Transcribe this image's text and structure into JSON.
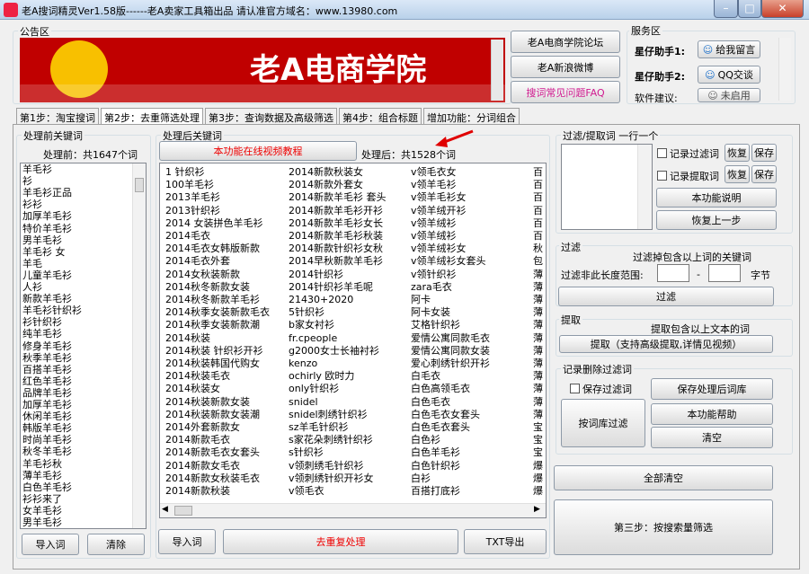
{
  "window": {
    "title": "老A搜词精灵Ver1.58版------老A卖家工具箱出品  请认准官方域名：www.13980.com"
  },
  "header": {
    "announcement_label": "公告区",
    "banner_text": "老A电商学院",
    "links": [
      "老A电商学院论坛",
      "老A新浪微博",
      "搜词常见问题FAQ"
    ],
    "service_label": "服务区",
    "assistant1_label": "星仔助手1:",
    "assistant1_btn": "给我留言",
    "assistant2_label": "星仔助手2:",
    "assistant2_btn": "QQ交谈",
    "suggest_label": "软件建议:",
    "suggest_btn": "未启用"
  },
  "tabs": [
    "第1步：淘宝搜词",
    "第2步：去重筛选处理",
    "第3步：查询数据及高级筛选",
    "第4步：组合标题",
    "增加功能：分词组合"
  ],
  "left": {
    "group_label": "处理前关键词",
    "count_label": "处理前：共1647个词",
    "keywords": [
      "羊毛衫",
      "衫",
      "羊毛衫正品",
      "衫衫",
      "加厚羊毛衫",
      "特价羊毛衫",
      "男羊毛衫",
      "羊毛衫 女",
      "羊毛",
      "儿童羊毛衫",
      "人衫",
      "新款羊毛衫",
      "羊毛衫针织衫",
      "衫针织衫",
      "纯羊毛衫",
      "修身羊毛衫",
      "秋季羊毛衫",
      "百搭羊毛衫",
      "红色羊毛衫",
      "品牌羊毛衫",
      "加厚羊毛衫",
      "休闲羊毛衫",
      "韩版羊毛衫",
      "时尚羊毛衫",
      "秋冬羊毛衫",
      "羊毛衫秋",
      "薄羊毛衫",
      "白色羊毛衫",
      "衫衫来了",
      "女羊毛衫",
      "男羊毛衫"
    ],
    "import_btn": "导入词",
    "clear_btn": "清除"
  },
  "middle": {
    "group_label": "处理后关键词",
    "video_btn": "本功能在线视频教程",
    "count_label": "处理后：共1528个词",
    "columns": [
      [
        "1 针织衫",
        "100羊毛衫",
        "2013羊毛衫",
        "2013针织衫",
        "2014 女装拼色羊毛衫",
        "2014毛衣",
        "2014毛衣女韩版新款",
        "2014毛衣外套",
        "2014女秋装新款",
        "2014秋冬新款女装",
        "2014秋冬新款羊毛衫",
        "2014秋季女装新款毛衣",
        "2014秋季女装新款潮",
        "2014秋装",
        "2014秋装 针织衫开衫",
        "2014秋装韩国代购女",
        "2014秋装毛衣",
        "2014秋装女",
        "2014秋装新款女装",
        "2014秋装新款女装潮",
        "2014外套新款女",
        "2014新款毛衣",
        "2014新款毛衣女套头",
        "2014新款女毛衣",
        "2014新款女秋装毛衣",
        "2014新款秋装"
      ],
      [
        "2014新款秋装女",
        "2014新款外套女",
        "2014新款羊毛衫 套头",
        "2014新款羊毛衫开衫",
        "2014新款羊毛衫女长",
        "2014新款羊毛衫秋装",
        "2014新款针织衫女秋",
        "2014早秋新款羊毛衫",
        "2014针织衫",
        "2014针织衫羊毛呢",
        "21430+2020",
        "5针织衫",
        "b家女衬衫",
        "fr.cpeople",
        "g2000女士长袖衬衫",
        "kenzo",
        "ochirly 欧时力",
        "only针织衫",
        "snidel",
        "snidel刺绣针织衫",
        "sz羊毛针织衫",
        "s家花朵刺绣针织衫",
        "s针织衫",
        "v领刺绣毛针织衫",
        "v领刺绣针织开衫女",
        "v领毛衣"
      ],
      [
        "v领毛衣女",
        "v领羊毛衫",
        "v领羊毛衫女",
        "v领羊绒开衫",
        "v领羊绒衫",
        "v领羊绒衫",
        "v领羊绒衫女",
        "v领羊绒衫女套头",
        "v领针织衫",
        "zara毛衣",
        "阿卡",
        "阿卡女装",
        "艾格针织衫",
        "爱情公寓同款毛衣",
        "爱情公寓同款女装",
        "爱心刺绣针织开衫",
        "白毛衣",
        "白色高领毛衣",
        "白色毛衣",
        "白色毛衣女套头",
        "白色毛衣套头",
        "白色衫",
        "白色羊毛衫",
        "白色针织衫",
        "白衫",
        "百搭打底衫"
      ],
      [
        "百",
        "百",
        "百",
        "百",
        "百",
        "百",
        "秋",
        "包",
        "薄",
        "薄",
        "薄",
        "薄",
        "薄",
        "薄",
        "薄",
        "薄",
        "薄",
        "薄",
        "薄",
        "薄",
        "宝",
        "宝",
        "宝",
        "爆",
        "爆",
        "爆"
      ]
    ],
    "import_btn": "导入词",
    "dedupe_btn": "去重复处理",
    "export_btn": "TXT导出"
  },
  "right": {
    "filter_group": "过滤/提取词 一行一个",
    "record_filter": "记录过滤词",
    "record_extract": "记录提取词",
    "restore": "恢复",
    "save": "保存",
    "help_btn": "本功能说明",
    "undo_btn": "恢复上一步",
    "filter_label": "过滤",
    "filter_desc": "过滤掉包含以上词的关键词",
    "length_label": "过滤非此长度范围:",
    "dash": "-",
    "unit": "字节",
    "filter_btn": "过滤",
    "extract_label": "提取",
    "extract_desc": "提取包含以上文本的词",
    "extract_btn": "提取（支持高级提取,详情见视频）",
    "record_label": "记录删除过滤词",
    "keep_filter": "保存过滤词",
    "lib_filter_btn": "按词库过滤",
    "save_lib_btn": "保存处理后词库",
    "help2_btn": "本功能帮助",
    "clear_btn": "清空",
    "clear_all_btn": "全部清空",
    "step3_btn": "第三步：按搜索量筛选"
  },
  "colors": {
    "arrow": "#e00000",
    "banner": "#c00000",
    "accent_link": "#d0198f"
  }
}
